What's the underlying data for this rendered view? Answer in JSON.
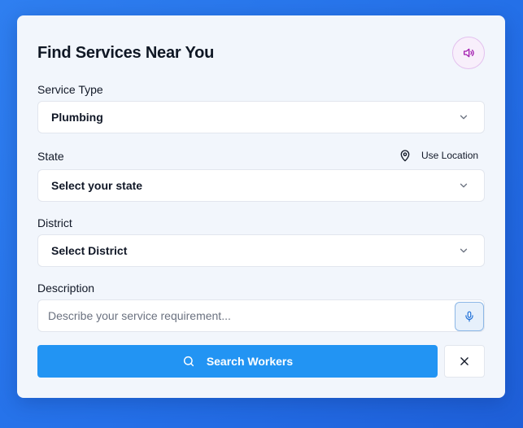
{
  "form": {
    "title": "Find Services Near You",
    "service_type": {
      "label": "Service Type",
      "value": "Plumbing"
    },
    "state": {
      "label": "State",
      "value": "Select your state",
      "use_location_label": "Use Location"
    },
    "district": {
      "label": "District",
      "value": "Select District"
    },
    "description": {
      "label": "Description",
      "placeholder": "Describe your service requirement...",
      "value": ""
    },
    "search_button_label": "Search Workers"
  },
  "icons": {
    "speaker": "speaker-icon",
    "chevron": "chevron-down-icon",
    "location": "map-pin-icon",
    "mic": "microphone-icon",
    "search": "search-icon",
    "close": "close-icon"
  },
  "colors": {
    "background": "#2a78ec",
    "card": "#f2f6fc",
    "primary_button": "#2294f3",
    "speaker_accent": "#a21caf",
    "mic_accent": "#1d6fd8"
  }
}
